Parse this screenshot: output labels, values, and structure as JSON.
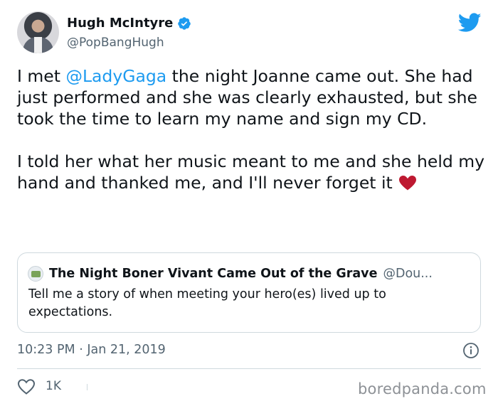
{
  "author": {
    "display_name": "Hugh McIntyre",
    "handle": "@PopBangHugh",
    "verified": true
  },
  "tweet": {
    "text_before_mention": "I met ",
    "mention": "@LadyGaga",
    "text_after_mention": " the night Joanne came out. She had just performed and she was clearly exhausted, but she took the time to learn my name and sign my CD.\n\nI told her what her music meant to me and she held my hand and thanked me, and I'll never forget it",
    "emoji": "heart-icon"
  },
  "quoted_tweet": {
    "name": "The Night Boner Vivant Came Out of the Grave",
    "handle": "@Dou...",
    "text": "Tell me a story of when meeting your hero(es) lived up to expectations."
  },
  "meta": {
    "timestamp": "10:23 PM · Jan 21, 2019"
  },
  "actions": {
    "like_count": "1K"
  },
  "watermark": "boredpanda.com",
  "colors": {
    "accent": "#1d9bf0",
    "text": "#0f1419",
    "muted": "#536471",
    "heart": "#be1931",
    "border": "#cfd9de"
  }
}
